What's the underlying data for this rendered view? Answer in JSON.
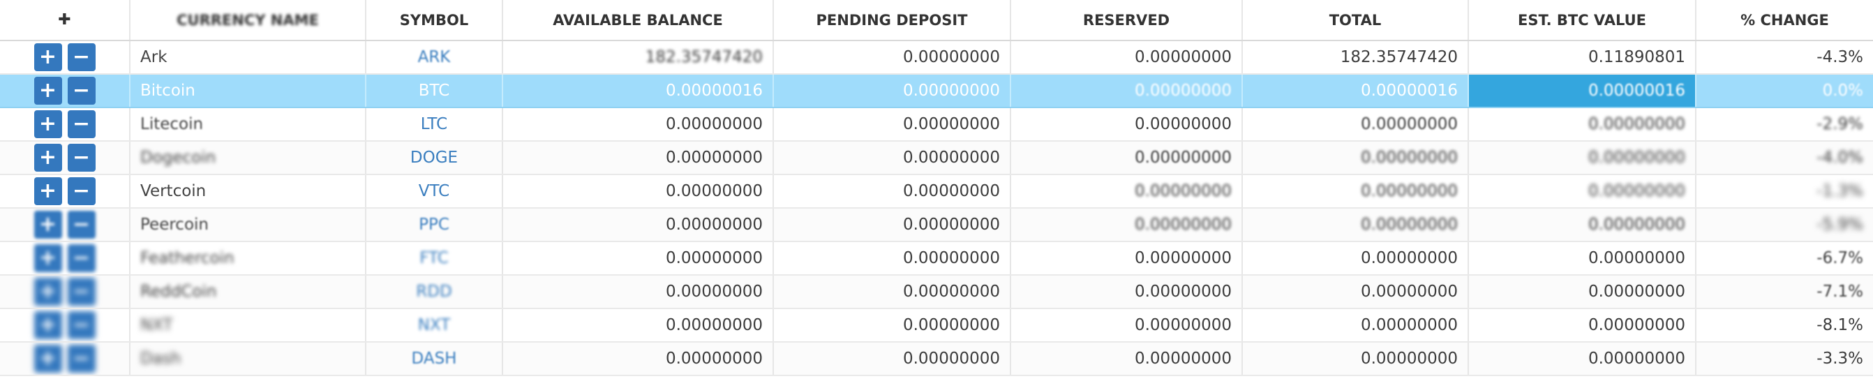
{
  "header": {
    "actions_icon": "✚",
    "columns": [
      "CURRENCY NAME",
      "SYMBOL",
      "AVAILABLE BALANCE",
      "PENDING DEPOSIT",
      "RESERVED",
      "TOTAL",
      "EST. BTC VALUE",
      "% CHANGE"
    ]
  },
  "buttons": {
    "deposit": "+",
    "withdraw": "−"
  },
  "rows": [
    {
      "name": "Ark",
      "symbol": "ARK",
      "available": "182.35747420",
      "pending": "0.00000000",
      "reserved": "0.00000000",
      "total": "182.35747420",
      "btc": "0.11890801",
      "change": "-4.3%"
    },
    {
      "name": "Bitcoin",
      "symbol": "BTC",
      "available": "0.00000016",
      "pending": "0.00000000",
      "reserved": "0.00000000",
      "total": "0.00000016",
      "btc": "0.00000016",
      "change": "0.0%"
    },
    {
      "name": "Litecoin",
      "symbol": "LTC",
      "available": "0.00000000",
      "pending": "0.00000000",
      "reserved": "0.00000000",
      "total": "0.00000000",
      "btc": "0.00000000",
      "change": "-2.9%"
    },
    {
      "name": "Dogecoin",
      "symbol": "DOGE",
      "available": "0.00000000",
      "pending": "0.00000000",
      "reserved": "0.00000000",
      "total": "0.00000000",
      "btc": "0.00000000",
      "change": "-4.0%"
    },
    {
      "name": "Vertcoin",
      "symbol": "VTC",
      "available": "0.00000000",
      "pending": "0.00000000",
      "reserved": "0.00000000",
      "total": "0.00000000",
      "btc": "0.00000000",
      "change": "-1.3%"
    },
    {
      "name": "Peercoin",
      "symbol": "PPC",
      "available": "0.00000000",
      "pending": "0.00000000",
      "reserved": "0.00000000",
      "total": "0.00000000",
      "btc": "0.00000000",
      "change": "-5.9%"
    },
    {
      "name": "Feathercoin",
      "symbol": "FTC",
      "available": "0.00000000",
      "pending": "0.00000000",
      "reserved": "0.00000000",
      "total": "0.00000000",
      "btc": "0.00000000",
      "change": "-6.7%"
    },
    {
      "name": "ReddCoin",
      "symbol": "RDD",
      "available": "0.00000000",
      "pending": "0.00000000",
      "reserved": "0.00000000",
      "total": "0.00000000",
      "btc": "0.00000000",
      "change": "-7.1%"
    },
    {
      "name": "NXT",
      "symbol": "NXT",
      "available": "0.00000000",
      "pending": "0.00000000",
      "reserved": "0.00000000",
      "total": "0.00000000",
      "btc": "0.00000000",
      "change": "-8.1%"
    },
    {
      "name": "Dash",
      "symbol": "DASH",
      "available": "0.00000000",
      "pending": "0.00000000",
      "reserved": "0.00000000",
      "total": "0.00000000",
      "btc": "0.00000000",
      "change": "-3.3%"
    }
  ]
}
